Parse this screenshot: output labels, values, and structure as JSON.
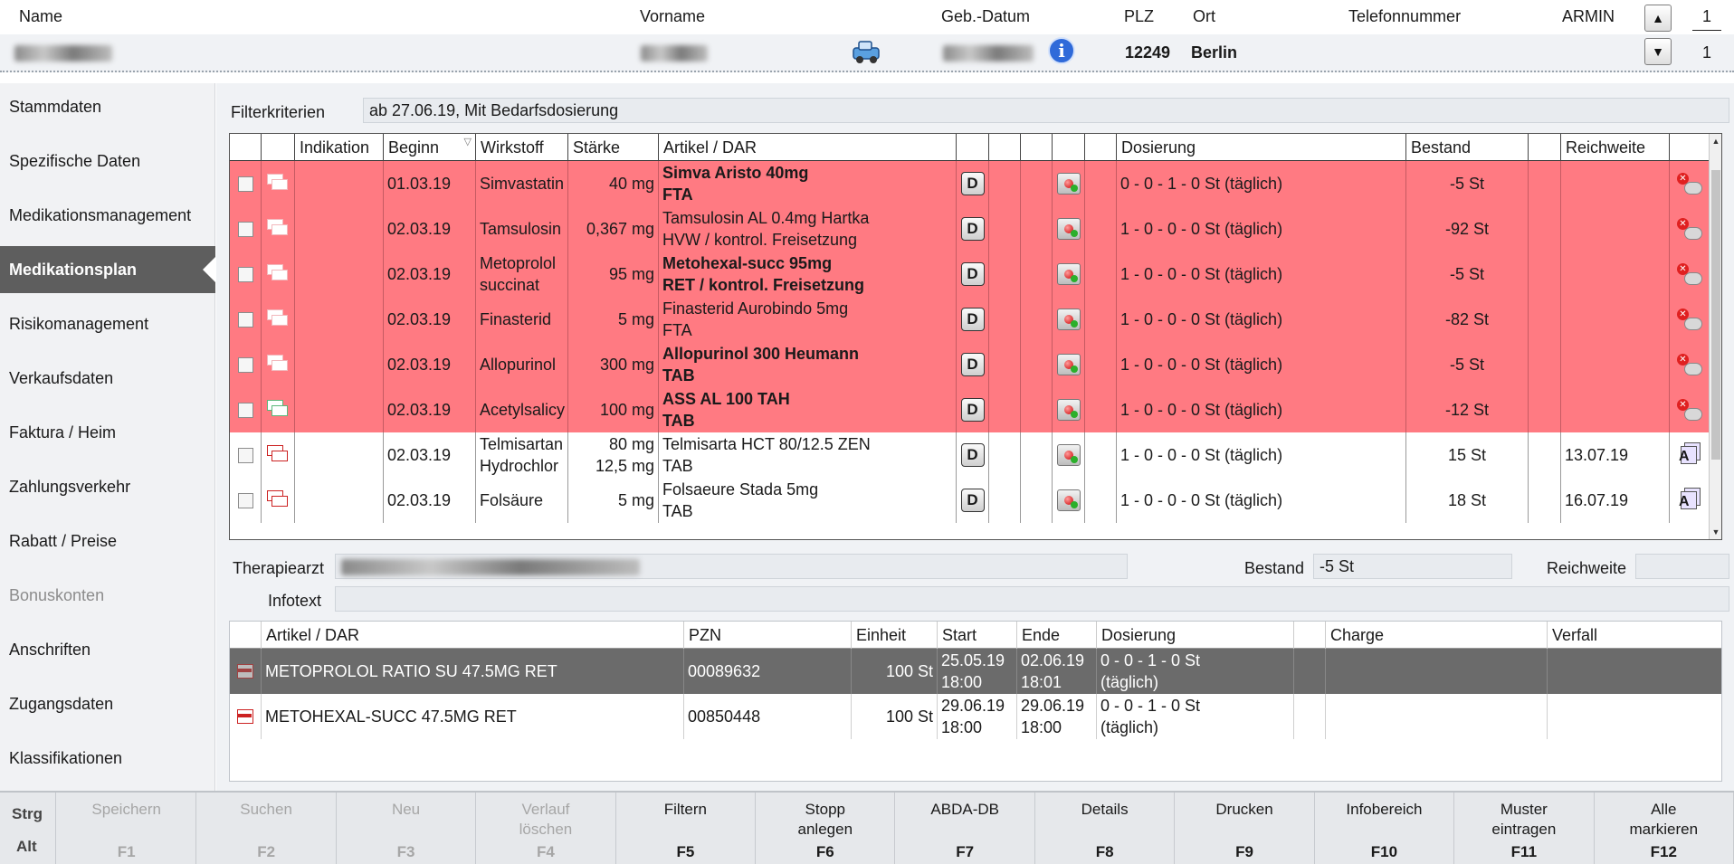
{
  "header": {
    "labels": {
      "name": "Name",
      "vorname": "Vorname",
      "geb_datum": "Geb.-Datum",
      "plz": "PLZ",
      "ort": "Ort",
      "telefon": "Telefonnummer",
      "user": "ARMIN"
    },
    "values": {
      "plz": "12249",
      "ort": "Berlin"
    },
    "counter_top": "1",
    "counter_bottom": "1"
  },
  "sidebar": {
    "items": [
      {
        "label": "Stammdaten",
        "state": "normal"
      },
      {
        "label": "Spezifische Daten",
        "state": "normal"
      },
      {
        "label": "Medikationsmanagement",
        "state": "normal"
      },
      {
        "label": "Medikationsplan",
        "state": "active"
      },
      {
        "label": "Risikomanagement",
        "state": "normal"
      },
      {
        "label": "Verkaufsdaten",
        "state": "normal"
      },
      {
        "label": "Faktura / Heim",
        "state": "normal"
      },
      {
        "label": "Zahlungsverkehr",
        "state": "normal"
      },
      {
        "label": "Rabatt / Preise",
        "state": "normal"
      },
      {
        "label": "Bonuskonten",
        "state": "disabled"
      },
      {
        "label": "Anschriften",
        "state": "normal"
      },
      {
        "label": "Zugangsdaten",
        "state": "normal"
      },
      {
        "label": "Klassifikationen",
        "state": "normal"
      }
    ]
  },
  "filter": {
    "label": "Filterkriterien",
    "value": "ab 27.06.19, Mit Bedarfsdosierung"
  },
  "med_table": {
    "columns": [
      "Indikation",
      "Beginn",
      "Wirkstoff",
      "Stärke",
      "Artikel / DAR",
      "Dosierung",
      "Bestand",
      "Reichweite"
    ],
    "rows": [
      {
        "highlight": true,
        "beginn": "01.03.19",
        "wirkstoff1": "Simvastatin",
        "wirkstoff2": "",
        "staerke1": "40 mg",
        "staerke2": "",
        "artikel1": "Simva Aristo 40mg",
        "artikel2": "FTA",
        "artikel_bold": true,
        "dosierung": "0 - 0 - 1 - 0 St (täglich)",
        "bestand": "-5 St",
        "reichweite": ""
      },
      {
        "highlight": true,
        "beginn": "02.03.19",
        "wirkstoff1": "Tamsulosin",
        "wirkstoff2": "",
        "staerke1": "0,367 mg",
        "staerke2": "",
        "artikel1": "Tamsulosin AL 0.4mg Hartka",
        "artikel2": "HVW / kontrol. Freisetzung",
        "artikel_bold": false,
        "dosierung": "1 - 0 - 0 - 0 St (täglich)",
        "bestand": "-92 St",
        "reichweite": ""
      },
      {
        "highlight": true,
        "beginn": "02.03.19",
        "wirkstoff1": "Metoprolol",
        "wirkstoff2": "succinat",
        "staerke1": "95 mg",
        "staerke2": "",
        "artikel1": "Metohexal-succ 95mg",
        "artikel2": "RET / kontrol. Freisetzung",
        "artikel_bold": true,
        "dosierung": "1 - 0 - 0 - 0 St (täglich)",
        "bestand": "-5 St",
        "reichweite": ""
      },
      {
        "highlight": true,
        "beginn": "02.03.19",
        "wirkstoff1": "Finasterid",
        "wirkstoff2": "",
        "staerke1": "5 mg",
        "staerke2": "",
        "artikel1": "Finasterid Aurobindo 5mg",
        "artikel2": "FTA",
        "artikel_bold": false,
        "dosierung": "1 - 0 - 0 - 0 St (täglich)",
        "bestand": "-82 St",
        "reichweite": ""
      },
      {
        "highlight": true,
        "beginn": "02.03.19",
        "wirkstoff1": "Allopurinol",
        "wirkstoff2": "",
        "staerke1": "300 mg",
        "staerke2": "",
        "artikel1": "Allopurinol 300 Heumann",
        "artikel2": "TAB",
        "artikel_bold": true,
        "dosierung": "1 - 0 - 0 - 0 St (täglich)",
        "bestand": "-5 St",
        "reichweite": ""
      },
      {
        "highlight": true,
        "beginn": "02.03.19",
        "wirkstoff1": "Acetylsalicy",
        "wirkstoff2": "",
        "staerke1": "100 mg",
        "staerke2": "",
        "artikel1": "ASS AL 100 TAH",
        "artikel2": "TAB",
        "artikel_bold": true,
        "dosierung": "1 - 0 - 0 - 0 St (täglich)",
        "bestand": "-12 St",
        "reichweite": ""
      },
      {
        "highlight": false,
        "beginn": "02.03.19",
        "wirkstoff1": "Telmisartan",
        "wirkstoff2": "Hydrochlor",
        "staerke1": "80 mg",
        "staerke2": "12,5 mg",
        "artikel1": "Telmisarta HCT 80/12.5 ZEN",
        "artikel2": "TAB",
        "artikel_bold": false,
        "dosierung": "1 - 0 - 0 - 0 St (täglich)",
        "bestand": "15 St",
        "reichweite": "13.07.19"
      },
      {
        "highlight": false,
        "beginn": "02.03.19",
        "wirkstoff1": "Folsäure",
        "wirkstoff2": "",
        "staerke1": "5 mg",
        "staerke2": "",
        "artikel1": "Folsaeure Stada 5mg",
        "artikel2": "TAB",
        "artikel_bold": false,
        "dosierung": "1 - 0 - 0 - 0 St (täglich)",
        "bestand": "18 St",
        "reichweite": "16.07.19"
      }
    ]
  },
  "detail": {
    "therapiearzt_label": "Therapiearzt",
    "bestand_label": "Bestand",
    "bestand_value": "-5 St",
    "reichweite_label": "Reichweite",
    "infotext_label": "Infotext"
  },
  "article_table": {
    "columns": [
      "Artikel / DAR",
      "PZN",
      "Einheit",
      "Start",
      "Ende",
      "Dosierung",
      "Charge",
      "Verfall"
    ],
    "rows": [
      {
        "selected": true,
        "artikel": "METOPROLOL RATIO SU 47.5MG RET",
        "pzn": "00089632",
        "einheit": "100 St",
        "start1": "25.05.19",
        "start2": "18:00",
        "ende1": "02.06.19",
        "ende2": "18:01",
        "dos1": "0 - 0 - 1 - 0 St",
        "dos2": "(täglich)"
      },
      {
        "selected": false,
        "artikel": "METOHEXAL-SUCC 47.5MG RET",
        "pzn": "00850448",
        "einheit": "100 St",
        "start1": "29.06.19",
        "start2": "18:00",
        "ende1": "29.06.19",
        "ende2": "18:00",
        "dos1": "0 - 0 - 1 - 0 St",
        "dos2": "(täglich)"
      }
    ]
  },
  "function_bar": {
    "modifier_top": "Strg",
    "modifier_bottom": "Alt",
    "keys": [
      {
        "label1": "Speichern",
        "label2": "",
        "key": "F1",
        "enabled": false
      },
      {
        "label1": "Suchen",
        "label2": "",
        "key": "F2",
        "enabled": false
      },
      {
        "label1": "Neu",
        "label2": "",
        "key": "F3",
        "enabled": false
      },
      {
        "label1": "Verlauf",
        "label2": "löschen",
        "key": "F4",
        "enabled": false
      },
      {
        "label1": "Filtern",
        "label2": "",
        "key": "F5",
        "enabled": true
      },
      {
        "label1": "Stopp",
        "label2": "anlegen",
        "key": "F6",
        "enabled": true
      },
      {
        "label1": "ABDA-DB",
        "label2": "",
        "key": "F7",
        "enabled": true
      },
      {
        "label1": "Details",
        "label2": "",
        "key": "F8",
        "enabled": true
      },
      {
        "label1": "Drucken",
        "label2": "",
        "key": "F9",
        "enabled": true
      },
      {
        "label1": "Infobereich",
        "label2": "",
        "key": "F10",
        "enabled": true
      },
      {
        "label1": "Muster",
        "label2": "eintragen",
        "key": "F11",
        "enabled": true
      },
      {
        "label1": "Alle",
        "label2": "markieren",
        "key": "F12",
        "enabled": true
      }
    ]
  },
  "colors": {
    "highlight_row": "#ff7a82",
    "selected_row": "#6b6b6b",
    "active_nav": "#5e5e5e"
  }
}
